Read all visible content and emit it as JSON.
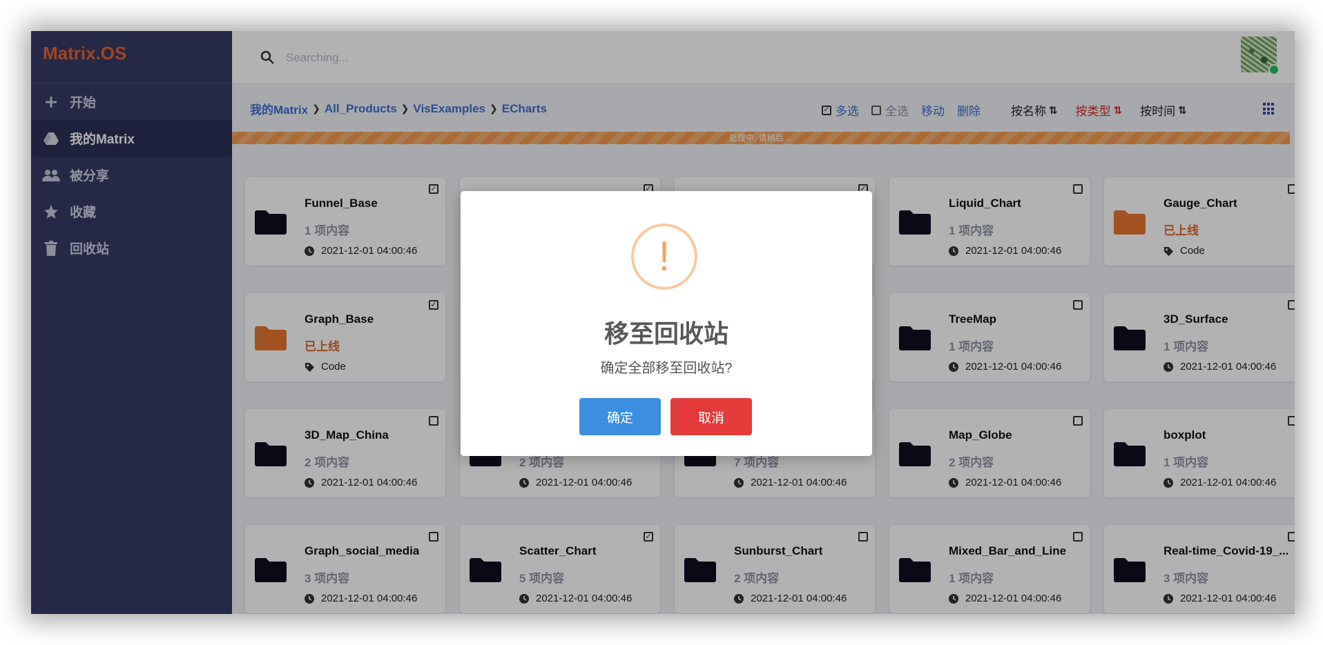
{
  "app": {
    "logo": "Matrix.OS"
  },
  "sidebar": {
    "items": [
      {
        "label": "开始",
        "icon": "plus-icon"
      },
      {
        "label": "我的Matrix",
        "icon": "drive-icon",
        "active": true
      },
      {
        "label": "被分享",
        "icon": "users-icon"
      },
      {
        "label": "收藏",
        "icon": "star-icon"
      },
      {
        "label": "回收站",
        "icon": "trash-icon"
      }
    ]
  },
  "search": {
    "placeholder": "Searching..."
  },
  "breadcrumb": [
    "我的Matrix",
    "All_Products",
    "VisExamples",
    "ECharts"
  ],
  "toolbar": {
    "multi_select": "多选",
    "select_all": "全选",
    "move": "移动",
    "delete": "删除",
    "sort_name": "按名称",
    "sort_type": "按类型",
    "sort_time": "按时间"
  },
  "progress": {
    "text": "处理中, 请稍后 ..."
  },
  "cards": [
    {
      "title": "Funnel_Base",
      "sub": "1 项内容",
      "meta": "2021-12-01 04:00:46",
      "checked": true
    },
    {
      "title": "",
      "sub": "",
      "meta": "",
      "checked": true
    },
    {
      "title": "",
      "sub": "",
      "meta": "",
      "checked": true
    },
    {
      "title": "Liquid_Chart",
      "sub": "1 项内容",
      "meta": "2021-12-01 04:00:46",
      "checked": false
    },
    {
      "title": "Gauge_Chart",
      "sub": "已上线",
      "meta": "Code",
      "checked": false,
      "live": true
    },
    {
      "title": "Graph_Base",
      "sub": "已上线",
      "meta": "Code",
      "checked": true,
      "live": true
    },
    {
      "title": "",
      "sub": "",
      "meta": "",
      "checked": false
    },
    {
      "title": "",
      "sub": "",
      "meta": "",
      "checked": false
    },
    {
      "title": "TreeMap",
      "sub": "1 项内容",
      "meta": "2021-12-01 04:00:46",
      "checked": false
    },
    {
      "title": "3D_Surface",
      "sub": "1 项内容",
      "meta": "2021-12-01 04:00:46",
      "checked": false
    },
    {
      "title": "3D_Map_China",
      "sub": "2 项内容",
      "meta": "2021-12-01 04:00:46",
      "checked": false
    },
    {
      "title": "",
      "sub": "2 项内容",
      "meta": "2021-12-01 04:00:46",
      "checked": false
    },
    {
      "title": "",
      "sub": "7 项内容",
      "meta": "2021-12-01 04:00:46",
      "checked": false
    },
    {
      "title": "Map_Globe",
      "sub": "2 项内容",
      "meta": "2021-12-01 04:00:46",
      "checked": false
    },
    {
      "title": "boxplot",
      "sub": "1 项内容",
      "meta": "2021-12-01 04:00:46",
      "checked": false
    },
    {
      "title": "Graph_social_media",
      "sub": "3 项内容",
      "meta": "2021-12-01 04:00:46",
      "checked": false
    },
    {
      "title": "Scatter_Chart",
      "sub": "5 项内容",
      "meta": "2021-12-01 04:00:46",
      "checked": true
    },
    {
      "title": "Sunburst_Chart",
      "sub": "2 项内容",
      "meta": "2021-12-01 04:00:46",
      "checked": false
    },
    {
      "title": "Mixed_Bar_and_Line",
      "sub": "1 项内容",
      "meta": "2021-12-01 04:00:46",
      "checked": false
    },
    {
      "title": "Real-time_Covid-19_...",
      "sub": "3 项内容",
      "meta": "2021-12-01 04:00:46",
      "checked": false
    }
  ],
  "modal": {
    "icon": "warning-icon",
    "title": "移至回收站",
    "text": "确定全部移至回收站?",
    "confirm": "确定",
    "cancel": "取消"
  },
  "colors": {
    "sidebar": "#353a66",
    "logo": "#e8642f",
    "link": "#3b6fd6",
    "confirm": "#3b8ee0",
    "cancel": "#e33b3b",
    "warning": "#f4a55e",
    "live": "#e0672a"
  }
}
